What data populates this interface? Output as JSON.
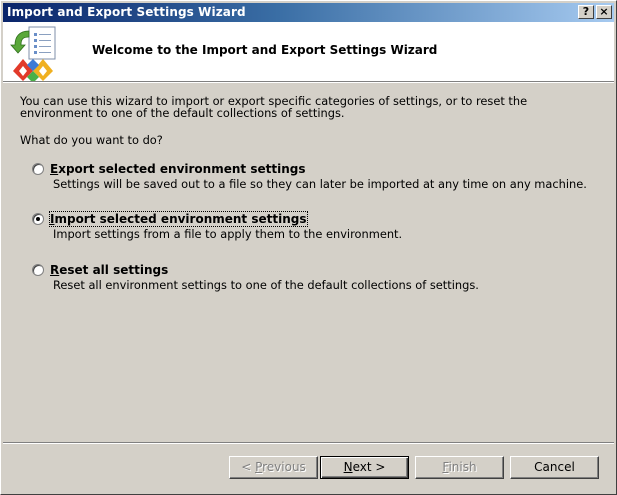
{
  "window": {
    "title": "Import and Export Settings Wizard",
    "help_button": "?",
    "close_button": "×"
  },
  "header": {
    "title": "Welcome to the Import and Export Settings Wizard"
  },
  "intro": {
    "line1": "You can use this wizard to import or export specific categories of settings, or to reset the",
    "line2": "environment to one of the default collections of settings."
  },
  "question": "What do you want to do?",
  "options": [
    {
      "label_hotkey": "E",
      "label_rest": "xport selected environment settings",
      "description": "Settings will be saved out to a file so they can later be imported at any time on any machine.",
      "selected": false
    },
    {
      "label_hotkey": "I",
      "label_rest": "mport selected environment settings",
      "description": "Import settings from a file to apply them to the environment.",
      "selected": true
    },
    {
      "label_hotkey": "R",
      "label_rest": "eset all settings",
      "description": "Reset all environment settings to one of the default collections of settings.",
      "selected": false
    }
  ],
  "buttons": {
    "previous": {
      "prefix": "< ",
      "hotkey": "P",
      "rest": "revious",
      "enabled": false
    },
    "next": {
      "hotkey": "N",
      "rest": "ext >",
      "enabled": true
    },
    "finish": {
      "hotkey": "F",
      "rest": "inish",
      "enabled": false
    },
    "cancel": {
      "label": "Cancel",
      "enabled": true
    }
  },
  "colors": {
    "titlebar_start": "#0a246a",
    "titlebar_end": "#a6caf0",
    "face": "#d4d0c8"
  },
  "icons": {
    "wizard": "import-export-settings-icon"
  }
}
